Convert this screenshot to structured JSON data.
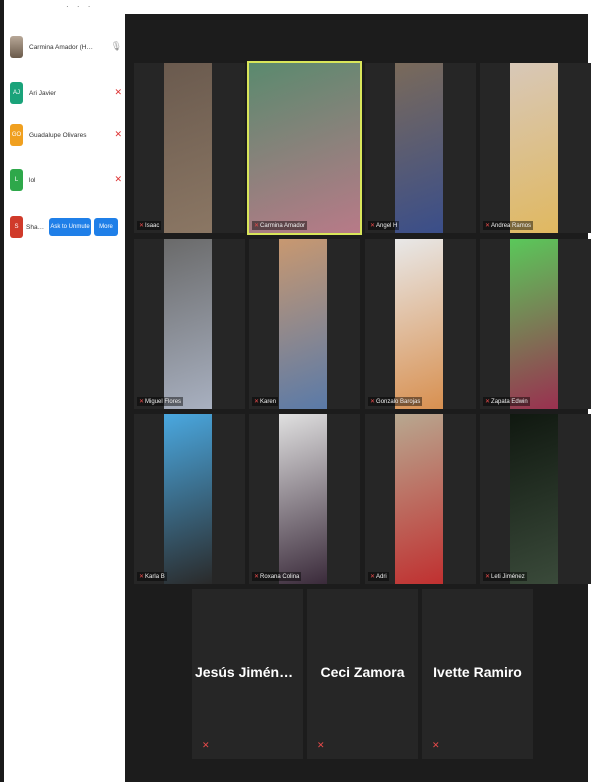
{
  "participants_panel": {
    "top_dots": "· · ·",
    "items": [
      {
        "name": "Carmina Amador (Host, me)",
        "initials": "",
        "color": "#8a7a6a",
        "mic": "mic-on-icon",
        "cam": "cam-off-icon"
      },
      {
        "name": "Ari Javier",
        "initials": "AJ",
        "color": "#1aa37a",
        "mic": "mic-muted-icon",
        "cam": "cam-muted-icon"
      },
      {
        "name": "Guadalupe Olivares",
        "initials": "GO",
        "color": "#f0a020",
        "mic": "mic-muted-icon",
        "cam": "cam-muted-icon"
      },
      {
        "name": "lol",
        "initials": "L",
        "color": "#2ea84a",
        "mic": "mic-muted-icon",
        "cam": "cam-muted-icon"
      },
      {
        "name": "Share...",
        "initials": "S",
        "color": "#d03a2a",
        "ask_to_unmute": "Ask to Unmute",
        "more": "More"
      }
    ]
  },
  "video_tiles": [
    {
      "name": "Isaac",
      "active": false,
      "colors": [
        "#6a5a4e",
        "#8b7764"
      ]
    },
    {
      "name": "Carmina Amador",
      "active": true,
      "colors": [
        "#5a8a6e",
        "#b87a88"
      ]
    },
    {
      "name": "Angel H",
      "active": false,
      "colors": [
        "#7a6a5a",
        "#3a4e8a"
      ]
    },
    {
      "name": "Andrea Ramos",
      "active": false,
      "colors": [
        "#d8c8b8",
        "#e0b860"
      ]
    },
    {
      "name": "Miguel Flores",
      "active": false,
      "colors": [
        "#6a6a6a",
        "#a8b0c0"
      ]
    },
    {
      "name": "Karen",
      "active": false,
      "colors": [
        "#c89870",
        "#5a7aa8"
      ]
    },
    {
      "name": "Gonzalo Barojas",
      "active": false,
      "colors": [
        "#e8e8e8",
        "#d89050"
      ]
    },
    {
      "name": "Zapata Edwin",
      "active": false,
      "colors": [
        "#5ac85a",
        "#9a3050"
      ]
    },
    {
      "name": "Karla B",
      "active": false,
      "colors": [
        "#4aa8e0",
        "#2a2a2a"
      ]
    },
    {
      "name": "Roxana Colina",
      "active": false,
      "colors": [
        "#e0e0e0",
        "#3a2a3a"
      ]
    },
    {
      "name": "Adri",
      "active": false,
      "colors": [
        "#b8a890",
        "#c03030"
      ]
    },
    {
      "name": "Leti Jiménez",
      "active": false,
      "colors": [
        "#101810",
        "#3a4a3a"
      ]
    }
  ],
  "name_tiles": [
    {
      "name": "Jesús Jiménez. V..."
    },
    {
      "name": "Ceci Zamora"
    },
    {
      "name": "Ivette Ramiro"
    }
  ]
}
